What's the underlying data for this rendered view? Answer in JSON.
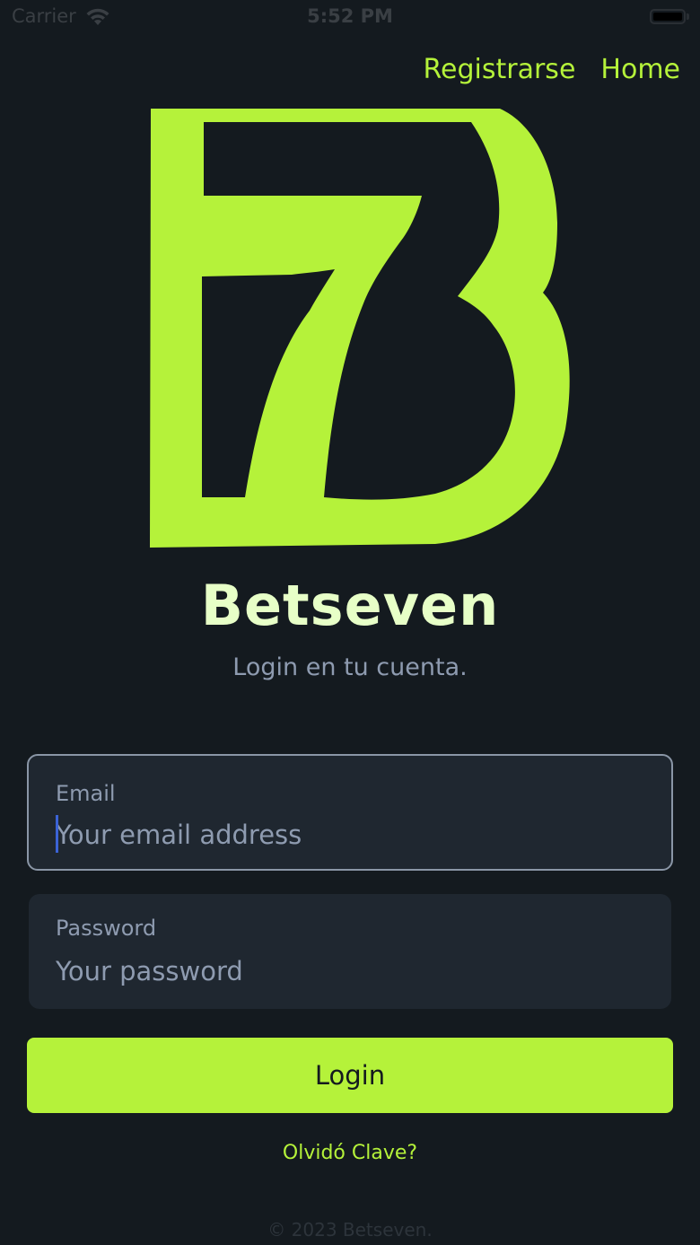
{
  "status_bar": {
    "carrier": "Carrier",
    "time": "5:52 PM",
    "wifi_icon": "wifi-icon",
    "battery_icon": "battery-icon"
  },
  "nav": {
    "register_label": "Registrarse",
    "home_label": "Home"
  },
  "logo": {
    "icon": "betseven-b7-logo",
    "color": "#b5f23a"
  },
  "brand": {
    "name": "Betseven",
    "subtitle": "Login en tu cuenta."
  },
  "form": {
    "email": {
      "label": "Email",
      "placeholder": "Your email address",
      "value": ""
    },
    "password": {
      "label": "Password",
      "placeholder": "Your password",
      "value": ""
    },
    "login_label": "Login",
    "forgot_label": "Olvidó Clave?"
  },
  "footer": {
    "copyright": "© 2023 Betseven."
  },
  "colors": {
    "background": "#141a1f",
    "accent": "#b5f23a",
    "field_bg": "#1f2730",
    "muted_text": "#8e9bb0"
  }
}
